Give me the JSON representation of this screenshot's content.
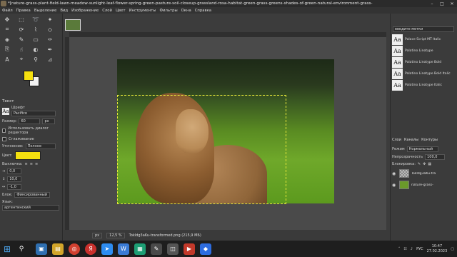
{
  "window": {
    "title": "*[nature-grass-plant-field-lawn-meadow-sunlight-leaf-flower-spring-green-pasture-soil-closeup-grassland-rosa-habitat-green-grass-greens-shades-of-green-natural-environment-grass-",
    "controls": [
      "–",
      "□",
      "✕"
    ]
  },
  "menu": [
    "Файл",
    "Правка",
    "Выделение",
    "Вид",
    "Изображение",
    "Слой",
    "Цвет",
    "Инструменты",
    "Фильтры",
    "Окна",
    "Справка"
  ],
  "tool_options": {
    "title": "Текст",
    "font_label": "Шрифт",
    "font_value": "Pacifico",
    "size_label": "Размер:",
    "size_value": "60",
    "size_unit": "px",
    "use_editor_label": "Использовать диалог редактора",
    "antialias_label": "Сглаживание",
    "hinting_label": "Уточнение:",
    "hinting_value": "Полное",
    "color_label": "Цвет:",
    "justify_label": "Выключка:",
    "indent_value": "0,0",
    "line_spacing_value": "10,0",
    "letter_spacing_value": "-1,0",
    "box_label": "Блок:",
    "box_value": "Фиксированный",
    "language_label": "Язык:",
    "language_value": "аргентинский",
    "fg_color": "#f5e00f",
    "bg_color": "#f2f2f2"
  },
  "fonts_panel": {
    "filter_placeholder": "введите метки",
    "fonts": [
      {
        "sample": "Aa",
        "name": "Palace Script MT Italic"
      },
      {
        "sample": "Aa",
        "name": "Palatino Linotype"
      },
      {
        "sample": "Aa",
        "name": "Palatino Linotype Bold"
      },
      {
        "sample": "Aa",
        "name": "Palatino Linotype Bold Italic"
      },
      {
        "sample": "Aa",
        "name": "Palatino Linotype Italic"
      }
    ]
  },
  "layers_panel": {
    "tabs": [
      "Слои",
      "Каналы",
      "Контуры"
    ],
    "mode_label": "Режим",
    "mode_value": "Нормальный",
    "opacity_label": "Непрозрачность",
    "opacity_value": "100,0",
    "lock_label": "Блокировка:",
    "layers": [
      {
        "name": "Tokldg3aKu-tra",
        "visible": true
      },
      {
        "name": "nature-grass-",
        "visible": true
      }
    ]
  },
  "status": {
    "unit": "px",
    "zoom": "12,5 %",
    "file_info": "Tokldg3aKu-transformed.png (215,9 МБ)"
  },
  "taskbar": {
    "lang": "РУС",
    "time": "10:47",
    "date": "27.02.2023"
  }
}
